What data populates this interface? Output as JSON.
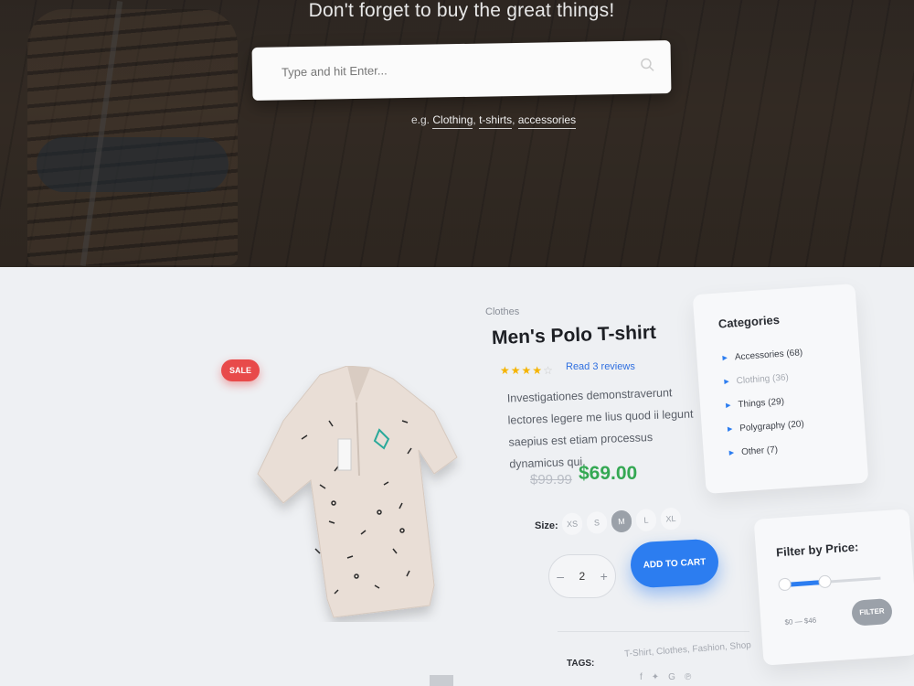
{
  "hero": {
    "headline": "Don't forget to buy the great things!",
    "search_placeholder": "Type and hit Enter...",
    "hint_prefix": "e.g.",
    "hints": [
      "Clothing",
      "t-shirts",
      "accessories"
    ]
  },
  "product": {
    "sale_badge": "SALE",
    "category": "Clothes",
    "title": "Men's Polo T-shirt",
    "rating": 3.5,
    "rating_max": 5,
    "reviews_link": "Read 3 reviews",
    "description": "Investigationes demonstraverunt lectores legere me lius quod ii legunt saepius est etiam processus dynamicus qui.",
    "old_price": "$99.99",
    "new_price": "$69.00",
    "size_label": "Size:",
    "sizes": [
      "XS",
      "S",
      "M",
      "L",
      "XL"
    ],
    "selected_size": "M",
    "quantity": "2",
    "qty_minus": "–",
    "qty_plus": "+",
    "add_to_cart": "ADD TO CART",
    "tags_label": "TAGS:",
    "tags": "T-Shirt, Clothes, Fashion, Shop"
  },
  "sidebar": {
    "categories_title": "Categories",
    "categories": [
      {
        "label": "Accessories (68)"
      },
      {
        "label": "Clothing (36)"
      },
      {
        "label": "Things (29)"
      },
      {
        "label": "Polygraphy (20)"
      },
      {
        "label": "Other (7)"
      }
    ],
    "price_title": "Filter by Price:",
    "price_range": "$0 — $46",
    "filter_button": "FILTER"
  },
  "colors": {
    "accent": "#2c7df0",
    "sale": "#e84a4a",
    "price": "#34a853",
    "star": "#f5b400"
  }
}
